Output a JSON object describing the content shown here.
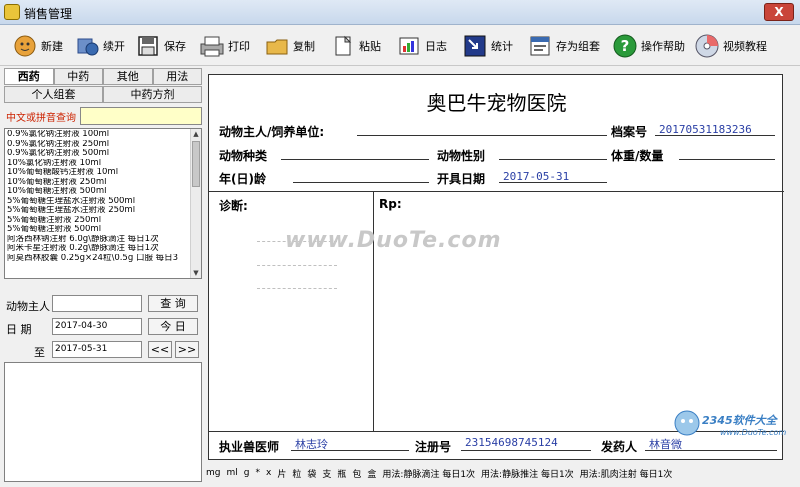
{
  "window": {
    "title": "销售管理",
    "close_label": "X"
  },
  "toolbar": [
    {
      "id": "new",
      "label": "新建",
      "icon": "new-icon"
    },
    {
      "id": "continue",
      "label": "续开",
      "icon": "continue-icon"
    },
    {
      "id": "save",
      "label": "保存",
      "icon": "save-icon"
    },
    {
      "id": "print",
      "label": "打印",
      "icon": "print-icon"
    },
    {
      "id": "copy",
      "label": "复制",
      "icon": "copy-icon"
    },
    {
      "id": "paste",
      "label": "粘贴",
      "icon": "paste-icon"
    },
    {
      "id": "log",
      "label": "日志",
      "icon": "log-icon"
    },
    {
      "id": "stats",
      "label": "统计",
      "icon": "stats-icon"
    },
    {
      "id": "saveset",
      "label": "存为组套",
      "icon": "save-set-icon"
    },
    {
      "id": "help",
      "label": "操作帮助",
      "icon": "help-icon"
    },
    {
      "id": "video",
      "label": "视频教程",
      "icon": "video-icon"
    }
  ],
  "tabs1": [
    "西药",
    "中药",
    "其他",
    "用法"
  ],
  "tabs2": [
    "个人组套",
    "中药方剂"
  ],
  "search": {
    "label": "中文或拼音查询",
    "value": ""
  },
  "drugs": [
    "0.9%氯化钠注射液  100ml",
    "0.9%氯化钠注射液  250ml",
    "0.9%氯化钠注射液  500ml",
    "10%氯化钠注射液  10ml",
    "10%葡萄糖酸钙注射液  10ml",
    "10%葡萄糖注射液  250ml",
    "10%葡萄糖注射液  500ml",
    "5%葡萄糖生理盐水注射液  500ml",
    "5%葡萄糖生理盐水注射液 250ml",
    "5%葡萄糖注射液  250ml",
    "5%葡萄糖注射液  500ml",
    "阿洛西林钠注射 6.0g\\静脉滴注  每日1次",
    "阿米卡星注射液 0.2g\\静脉滴注 每日1次",
    "阿莫西林胶囊 0.25g×24粒\\0.5g 口服 每日3"
  ],
  "filter": {
    "owner_label": "动物主人",
    "owner_value": "",
    "query_btn": "查 询",
    "date_label": "日  期",
    "date_from": "2017-04-30",
    "today_btn": "今 日",
    "to_label": "至",
    "date_to": "2017-05-31",
    "prev_btn": "<<",
    "next_btn": ">>"
  },
  "rx": {
    "hospital": "奥巴牛宠物医院",
    "owner_label": "动物主人/饲养单位:",
    "owner_value": "",
    "file_label": "档案号",
    "file_value": "20170531183236",
    "species_label": "动物种类",
    "species_value": "",
    "sex_label": "动物性别",
    "sex_value": "",
    "weight_label": "体重/数量",
    "weight_value": "",
    "age_label": "年(日)龄",
    "age_value": "",
    "date_label": "开具日期",
    "date_value": "2017-05-31",
    "diag_label": "诊断:",
    "rp_label": "Rp:",
    "vet_label": "执业兽医师",
    "vet_value": "林志玲",
    "reg_label": "注册号",
    "reg_value": "23154698745124",
    "dispenser_label": "发药人",
    "dispenser_value": "林音微"
  },
  "watermark": "www.DuoTe.com",
  "logo": {
    "brand": "2345软件大全",
    "url": "www.DuoTe.com"
  },
  "statusbar": [
    "mg",
    "ml",
    "g",
    "*",
    "x",
    "片",
    "粒",
    "袋",
    "支",
    "瓶",
    "包",
    "盒",
    "用法:静脉滴注 每日1次",
    "用法:静脉推注 每日1次",
    "用法:肌肉注射 每日1次"
  ]
}
